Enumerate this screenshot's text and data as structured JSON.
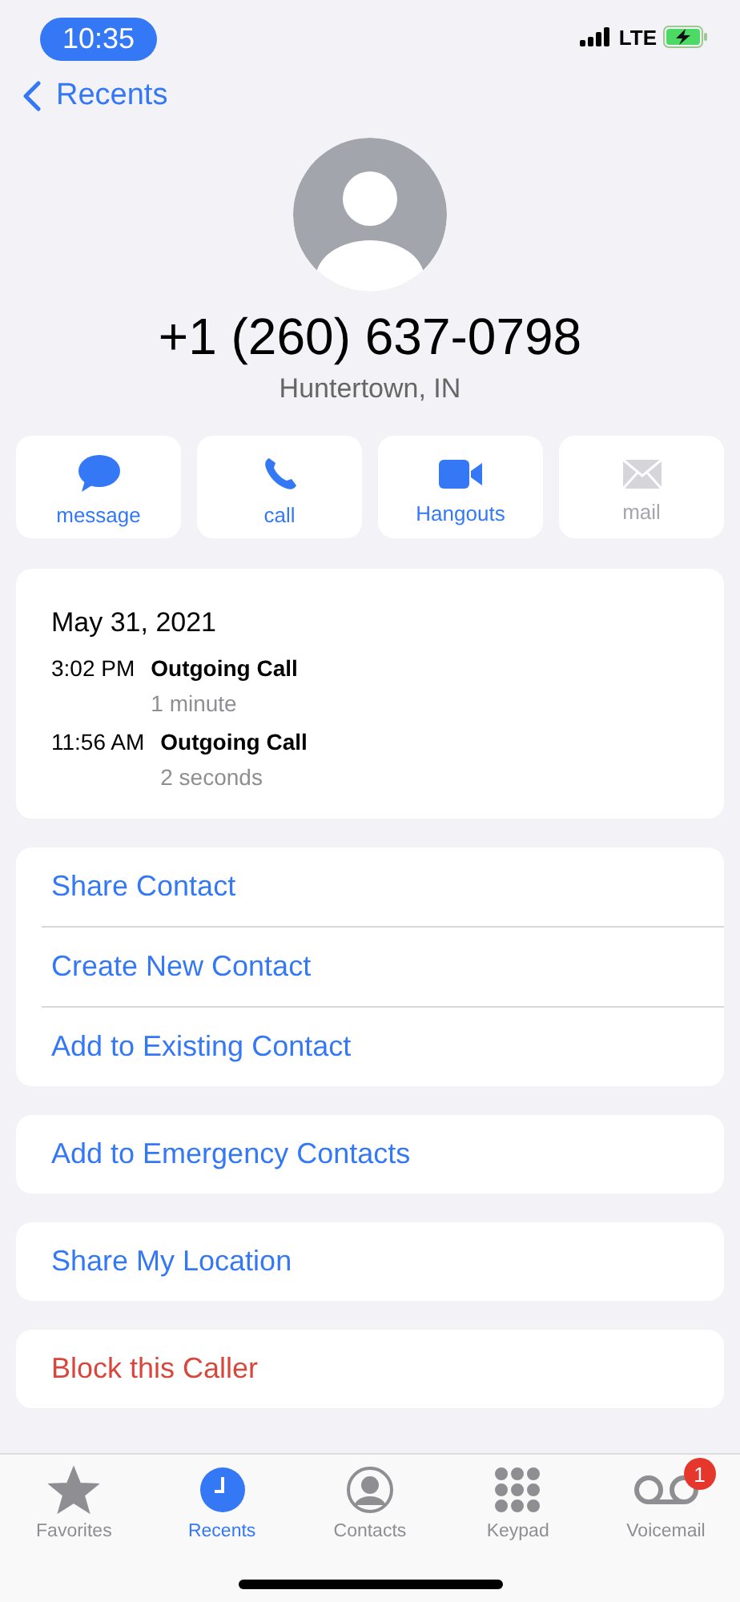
{
  "status_bar": {
    "time": "10:35",
    "network": "LTE"
  },
  "nav": {
    "back": "Recents"
  },
  "contact": {
    "phone": "+1 (260) 637-0798",
    "location": "Huntertown, IN"
  },
  "actions": [
    {
      "kind": "message",
      "label": "message",
      "disabled": false
    },
    {
      "kind": "call",
      "label": "call",
      "disabled": false
    },
    {
      "kind": "video",
      "label": "Hangouts",
      "disabled": false
    },
    {
      "kind": "mail",
      "label": "mail",
      "disabled": true
    }
  ],
  "call_history": {
    "date": "May 31, 2021",
    "calls": [
      {
        "time": "3:02 PM",
        "type": "Outgoing Call",
        "duration": "1 minute"
      },
      {
        "time": "11:56 AM",
        "type": "Outgoing Call",
        "duration": "2 seconds"
      }
    ]
  },
  "option_groups": [
    [
      {
        "label": "Share Contact",
        "destructive": false
      },
      {
        "label": "Create New Contact",
        "destructive": false
      },
      {
        "label": "Add to Existing Contact",
        "destructive": false
      }
    ],
    [
      {
        "label": "Add to Emergency Contacts",
        "destructive": false
      }
    ],
    [
      {
        "label": "Share My Location",
        "destructive": false
      }
    ],
    [
      {
        "label": "Block this Caller",
        "destructive": true
      }
    ]
  ],
  "tabs": [
    {
      "kind": "favorites",
      "label": "Favorites",
      "selected": false
    },
    {
      "kind": "recents",
      "label": "Recents",
      "selected": true
    },
    {
      "kind": "contacts",
      "label": "Contacts",
      "selected": false
    },
    {
      "kind": "keypad",
      "label": "Keypad",
      "selected": false
    },
    {
      "kind": "voicemail",
      "label": "Voicemail",
      "selected": false,
      "badge": "1"
    }
  ]
}
